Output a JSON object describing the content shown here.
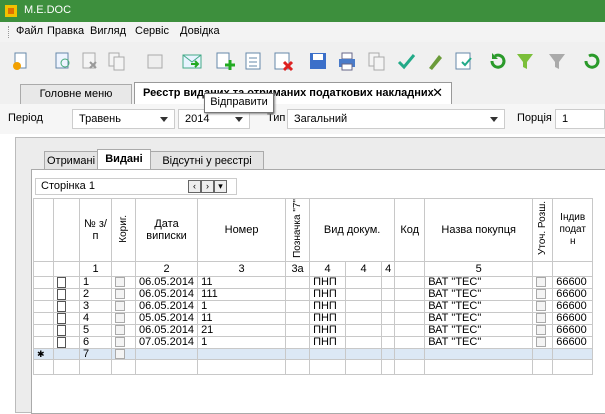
{
  "window": {
    "title": "M.E.DOC"
  },
  "menu": [
    "Файл",
    "Правка",
    "Вигляд",
    "Сервіс",
    "Довідка"
  ],
  "toolbar": {
    "buttons": [
      "new-doc-icon",
      "preview-icon",
      "delete-icon",
      "copy-icon",
      "archive-icon",
      "send-icon",
      "add-green-icon",
      "edit-list-icon",
      "delete-list-icon",
      "save-icon",
      "print-icon",
      "copy2-icon",
      "check-icon",
      "sign-icon",
      "export-icon",
      "refresh-icon",
      "filter-icon",
      "clear-filter-icon",
      "sync-icon"
    ],
    "tooltip": "Відправити"
  },
  "tabs": [
    {
      "label": "Головне меню"
    },
    {
      "label": "Реєстр виданих та отриманих податкових накладних",
      "close": "✕"
    }
  ],
  "filter": {
    "period_label": "Період",
    "month": "Травень",
    "year": "2014",
    "type_label": "Тип",
    "type_value": "Загальний",
    "portion_label": "Порція",
    "portion_value": "1"
  },
  "inner_tabs": [
    "Отримані",
    "Видані",
    "Відсутні у реєстрі"
  ],
  "pager": {
    "label": "Сторінка 1"
  },
  "grid": {
    "headers": {
      "num": "№ з/п",
      "korig": "Кориг.",
      "date": "Дата виписки",
      "number": "Номер",
      "oznaka": "Позначка \"7\"",
      "vid": "Вид докум.",
      "kod": "Код",
      "buyer": "Назва покупця",
      "utoch": "Уточ. Розш.",
      "inn": "Індив подат н"
    },
    "col_numbers": [
      "1",
      "2",
      "3",
      "3а",
      "4",
      "4",
      "4",
      "5"
    ],
    "rows": [
      {
        "n": "1",
        "date": "06.05.2014",
        "num": "11",
        "vid": "ПНП",
        "buyer": "ВАТ \"ТЕС\"",
        "inn": "66600"
      },
      {
        "n": "2",
        "date": "06.05.2014",
        "num": "111",
        "vid": "ПНП",
        "buyer": "ВАТ \"ТЕС\"",
        "inn": "66600"
      },
      {
        "n": "3",
        "date": "06.05.2014",
        "num": "1",
        "vid": "ПНП",
        "buyer": "ВАТ \"ТЕС\"",
        "inn": "66600"
      },
      {
        "n": "4",
        "date": "05.05.2014",
        "num": "11",
        "vid": "ПНП",
        "buyer": "ВАТ \"ТЕС\"",
        "inn": "66600"
      },
      {
        "n": "5",
        "date": "06.05.2014",
        "num": "21",
        "vid": "ПНП",
        "buyer": "ВАТ \"ТЕС\"",
        "inn": "66600"
      },
      {
        "n": "6",
        "date": "07.05.2014",
        "num": "1",
        "vid": "ПНП",
        "buyer": "ВАТ \"ТЕС\"",
        "inn": "66600"
      }
    ],
    "new_row": {
      "marker": "✱",
      "n": "7"
    }
  },
  "colors": {
    "titlebar": "#3d8f3d",
    "highlight": "#b22222",
    "new_row": "#dce8f5"
  }
}
